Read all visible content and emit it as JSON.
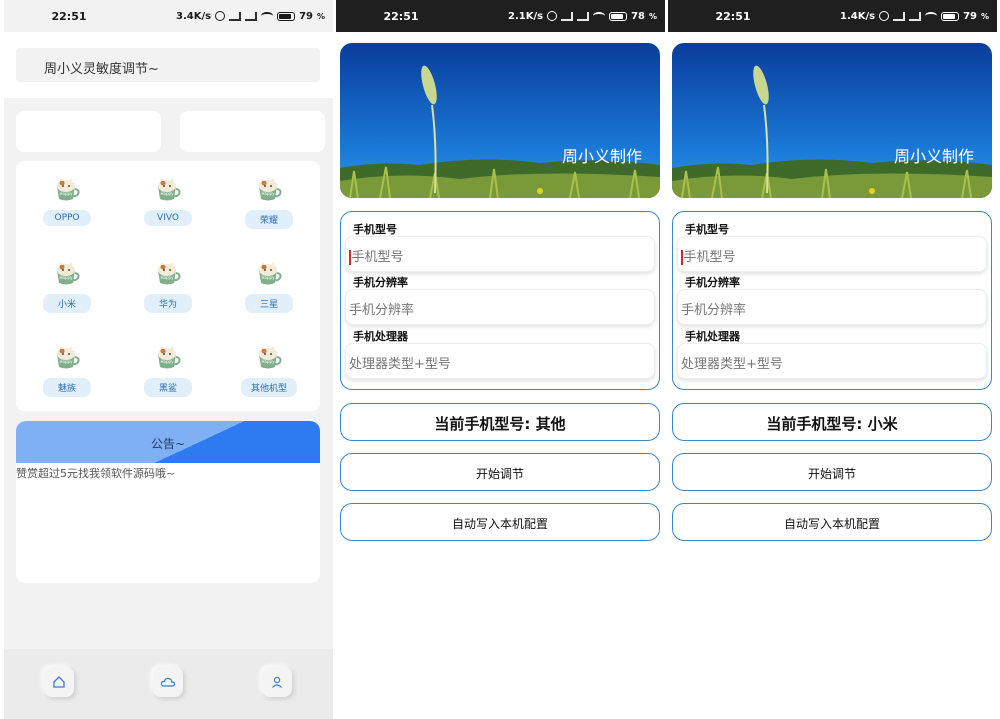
{
  "screens": [
    {
      "status": {
        "time": "22:51",
        "speed": "3.4K/s",
        "battery": "79"
      },
      "title": "周小义灵敏度调节~",
      "brands": [
        {
          "label": "OPPO"
        },
        {
          "label": "VIVO"
        },
        {
          "label": "荣耀"
        },
        {
          "label": "小米"
        },
        {
          "label": "华为"
        },
        {
          "label": "三星"
        },
        {
          "label": "魅族"
        },
        {
          "label": "黑鲨"
        },
        {
          "label": "其他机型"
        }
      ],
      "notice": {
        "title": "公告~",
        "text": "赞赏超过5元找我领软件源码哦~"
      },
      "nav": [
        "home-icon",
        "cloud-icon",
        "user-icon"
      ]
    },
    {
      "status": {
        "time": "22:51",
        "speed": "2.1K/s",
        "battery": "78"
      },
      "banner_text": "周小义制作",
      "form": {
        "model_label": "手机型号",
        "model_placeholder": "手机型号",
        "res_label": "手机分辨率",
        "res_placeholder": "手机分辨率",
        "cpu_label": "手机处理器",
        "cpu_placeholder": "处理器类型+型号"
      },
      "current_model": "当前手机型号: 其他",
      "start_button": "开始调节",
      "write_button": "自动写入本机配置"
    },
    {
      "status": {
        "time": "22:51",
        "speed": "1.4K/s",
        "battery": "79"
      },
      "banner_text": "周小义制作",
      "form": {
        "model_label": "手机型号",
        "model_placeholder": "手机型号",
        "res_label": "手机分辨率",
        "res_placeholder": "手机分辨率",
        "cpu_label": "手机处理器",
        "cpu_placeholder": "处理器类型+型号"
      },
      "current_model": "当前手机型号: 小米",
      "start_button": "开始调节",
      "write_button": "自动写入本机配置"
    }
  ],
  "colors": {
    "accent": "#3b88c8",
    "notice_blue": "#2e7bf0",
    "label_bg": "#e1effa"
  }
}
